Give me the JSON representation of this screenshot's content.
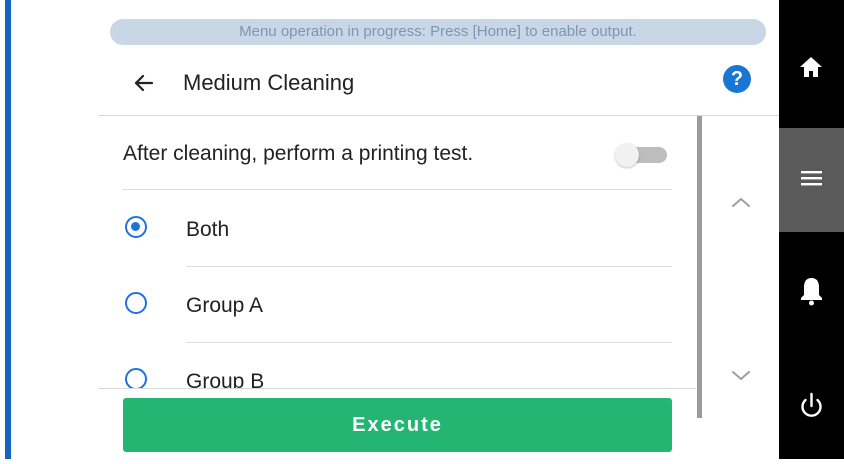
{
  "banner": {
    "text": "Menu operation in progress: Press [Home] to enable output."
  },
  "header": {
    "title": "Medium Cleaning",
    "help_label": "?"
  },
  "settings": {
    "printing_test_label": "After cleaning, perform a printing test.",
    "printing_test_enabled": false
  },
  "options": [
    {
      "label": "Both",
      "selected": true
    },
    {
      "label": "Group A",
      "selected": false
    },
    {
      "label": "Group B",
      "selected": false
    }
  ],
  "actions": {
    "execute_label": "Execute"
  },
  "colors": {
    "accent_blue": "#1e73d8",
    "execute_green": "#25b573",
    "banner_bg": "#c9d6e5",
    "banner_text": "#7e95b4",
    "sidebar_bg": "#000000",
    "sidebar_active": "#5a5a5a",
    "left_stripe": "#1565c0"
  },
  "icons": {
    "back": "arrow-left-icon",
    "help": "question-mark-icon",
    "scroll_up": "chevron-up-icon",
    "scroll_down": "chevron-down-icon",
    "home": "home-icon",
    "menu": "menu-icon",
    "notification": "bell-icon",
    "power": "power-icon"
  }
}
